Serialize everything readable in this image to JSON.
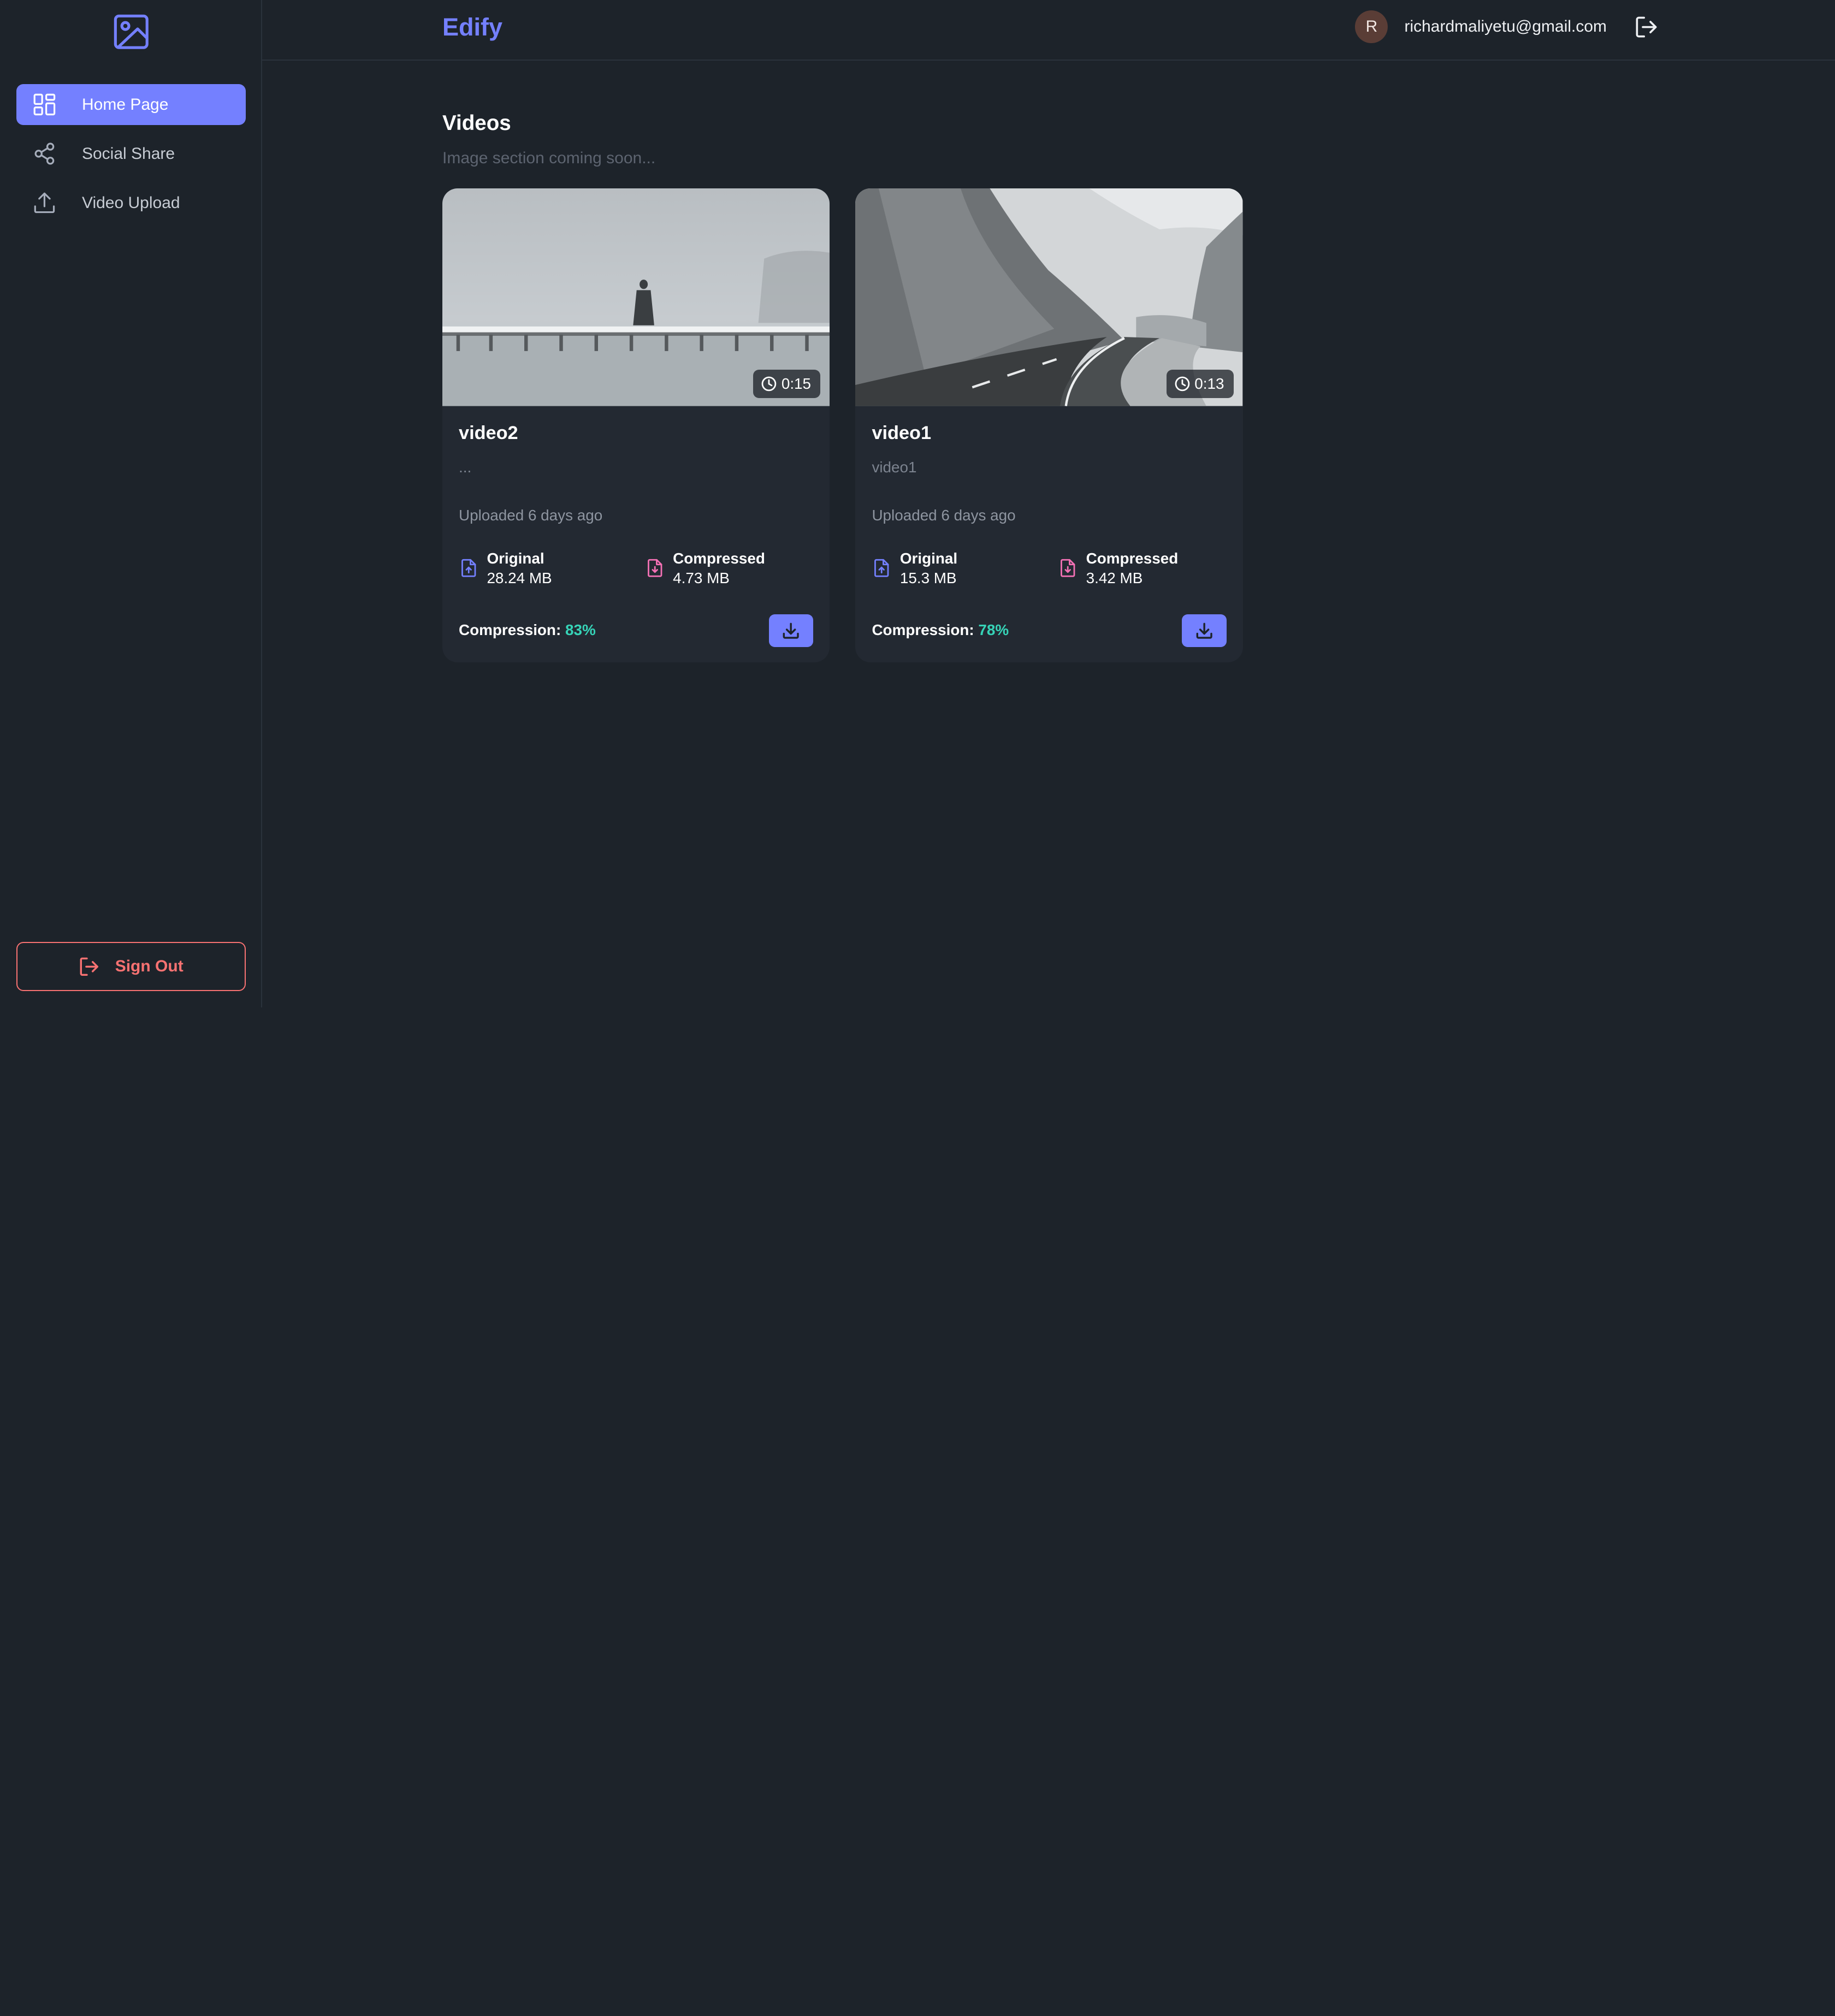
{
  "brand": {
    "name": "Edify",
    "logo_icon": "image-icon"
  },
  "user": {
    "avatar_initial": "R",
    "email": "richardmaliyetu@gmail.com"
  },
  "sidebar": {
    "items": [
      {
        "label": "Home Page",
        "icon": "grid-icon",
        "active": true
      },
      {
        "label": "Social Share",
        "icon": "share-icon",
        "active": false
      },
      {
        "label": "Video Upload",
        "icon": "upload-icon",
        "active": false
      }
    ],
    "sign_out_label": "Sign Out"
  },
  "main": {
    "title": "Videos",
    "subtitle": "Image section coming soon...",
    "videos": [
      {
        "title": "video2",
        "description": "...",
        "duration": "0:15",
        "uploaded": "Uploaded 6 days ago",
        "original_label": "Original",
        "original_size": "28.24 MB",
        "compressed_label": "Compressed",
        "compressed_size": "4.73 MB",
        "compression_label": "Compression:",
        "compression_pct": "83%"
      },
      {
        "title": "video1",
        "description": "video1",
        "duration": "0:13",
        "uploaded": "Uploaded 6 days ago",
        "original_label": "Original",
        "original_size": "15.3 MB",
        "compressed_label": "Compressed",
        "compressed_size": "3.42 MB",
        "compression_label": "Compression:",
        "compression_pct": "78%"
      }
    ]
  },
  "colors": {
    "accent": "#7480ff",
    "danger": "#f87272",
    "success": "#36d3b7",
    "background": "#1d232a",
    "card": "#232932"
  }
}
